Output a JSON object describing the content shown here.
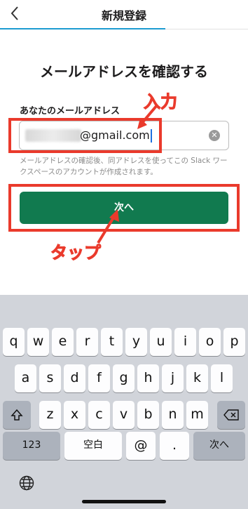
{
  "header": {
    "back_icon": "chevron-left-icon",
    "title": "新規登録"
  },
  "page": {
    "heading": "メールアドレスを確認する",
    "field_label": "あなたのメールアドレス",
    "email_value": "@gmail.com",
    "hint": "メールアドレスの確認後、同アドレスを使ってこの Slack ワークスペースのアカウントが作成されます。",
    "next_button": "次へ"
  },
  "annotations": {
    "input_label": "入力",
    "tap_label": "タップ",
    "color": "#ea3a2c"
  },
  "keyboard": {
    "row1": [
      "q",
      "w",
      "e",
      "r",
      "t",
      "y",
      "u",
      "i",
      "o",
      "p"
    ],
    "row2": [
      "a",
      "s",
      "d",
      "f",
      "g",
      "h",
      "j",
      "k",
      "l"
    ],
    "row3": [
      "z",
      "x",
      "c",
      "v",
      "b",
      "n",
      "m"
    ],
    "shift_icon": "shift-icon",
    "delete_icon": "delete-icon",
    "num_key": "123",
    "space_key": "空白",
    "at_key": "@",
    "dot_key": ".",
    "return_key": "次へ",
    "globe_icon": "globe-icon"
  },
  "colors": {
    "primary_button": "#117a4f",
    "progress": "#1d9bd1"
  }
}
